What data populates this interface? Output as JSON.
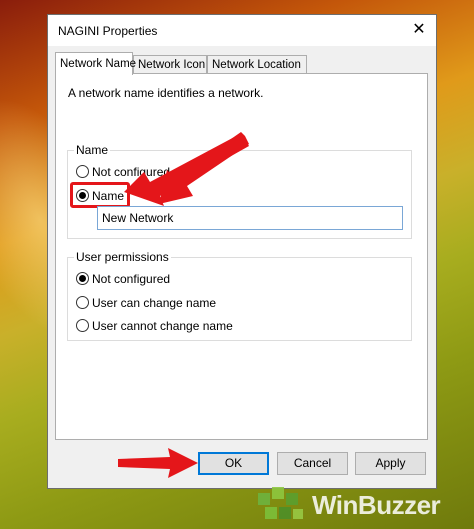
{
  "window": {
    "title": "NAGINI Properties",
    "close_glyph": "✕"
  },
  "tabs": [
    {
      "label": "Network Name",
      "active": true
    },
    {
      "label": "Network Icon",
      "active": false
    },
    {
      "label": "Network Location",
      "active": false
    }
  ],
  "panel": {
    "description": "A network name identifies a network.",
    "name_group": {
      "label": "Name",
      "options": [
        {
          "label": "Not configured",
          "checked": false
        },
        {
          "label": "Name",
          "checked": true
        }
      ],
      "name_value": "New Network"
    },
    "permissions_group": {
      "label": "User permissions",
      "options": [
        {
          "label": "Not configured",
          "checked": true
        },
        {
          "label": "User can change name",
          "checked": false
        },
        {
          "label": "User cannot change name",
          "checked": false
        }
      ]
    }
  },
  "buttons": {
    "ok": "OK",
    "cancel": "Cancel",
    "apply": "Apply"
  },
  "colors": {
    "annotation_red": "#e4161a",
    "focus_blue": "#0078d7"
  },
  "watermark": {
    "text": "WinBuzzer"
  }
}
